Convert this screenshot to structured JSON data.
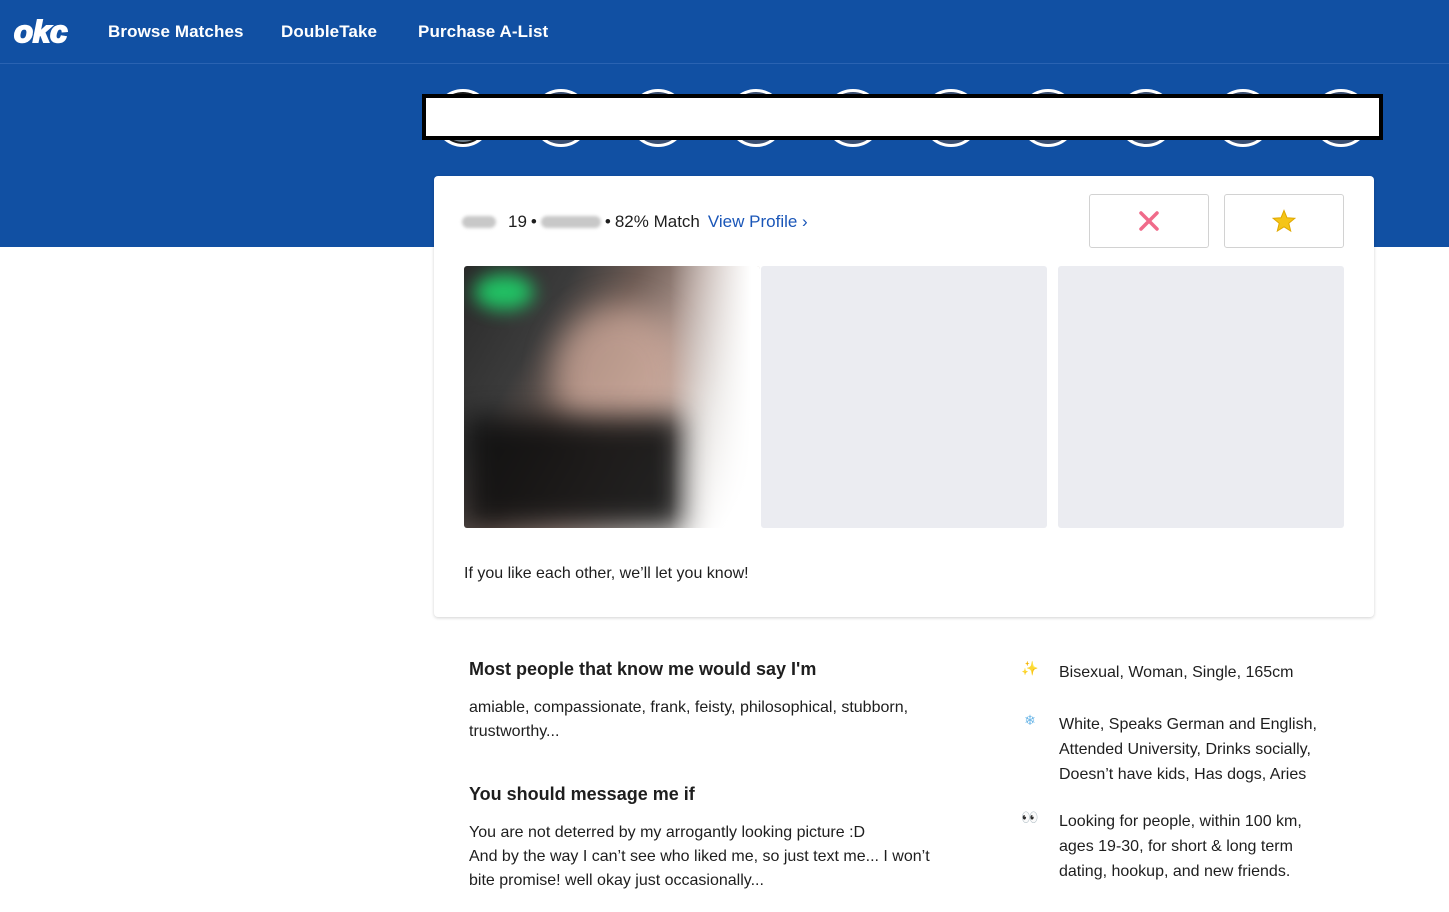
{
  "header": {
    "logo_text": "okc",
    "nav": [
      {
        "label": "Browse Matches"
      },
      {
        "label": "DoubleTake"
      },
      {
        "label": "Purchase A-List"
      }
    ]
  },
  "profile_card": {
    "age": "19",
    "separator": "•",
    "match": "82% Match",
    "view_profile_label": "View Profile ›",
    "pass_icon": "x-icon",
    "like_icon": "star-icon",
    "like_note": "If you like each other, we’ll let you know!"
  },
  "essays": [
    {
      "title": "Most people that know me would say I'm",
      "lines": [
        "amiable, compassionate, frank, feisty, philosophical, stubborn,",
        "trustworthy..."
      ]
    },
    {
      "title": "You should message me if",
      "lines": [
        "You are not deterred by my arrogantly looking picture :D",
        "And by the way I can’t see who liked me, so just text me... I won’t",
        "bite promise! well okay just occasionally..."
      ]
    }
  ],
  "details": [
    {
      "icon": "✨",
      "icon_name": "sparkles-icon",
      "lines": [
        "Bisexual, Woman, Single, 165cm"
      ]
    },
    {
      "icon": "❄",
      "icon_name": "snowflake-icon",
      "lines": [
        "White, Speaks German and English,",
        "Attended University, Drinks socially,",
        "Doesn’t have kids, Has dogs, Aries"
      ]
    },
    {
      "icon": "👀",
      "icon_name": "eyes-icon",
      "lines": [
        "Looking for people, within 100 km,",
        "ages 19-30, for short & long term",
        "dating, hookup, and new friends."
      ]
    }
  ],
  "colors": {
    "brand_blue": "#1150a3",
    "link_blue": "#1a56b8",
    "pass_pink": "#f06b8a",
    "star_yellow": "#f5c518",
    "photo_placeholder": "#ebecf1"
  }
}
